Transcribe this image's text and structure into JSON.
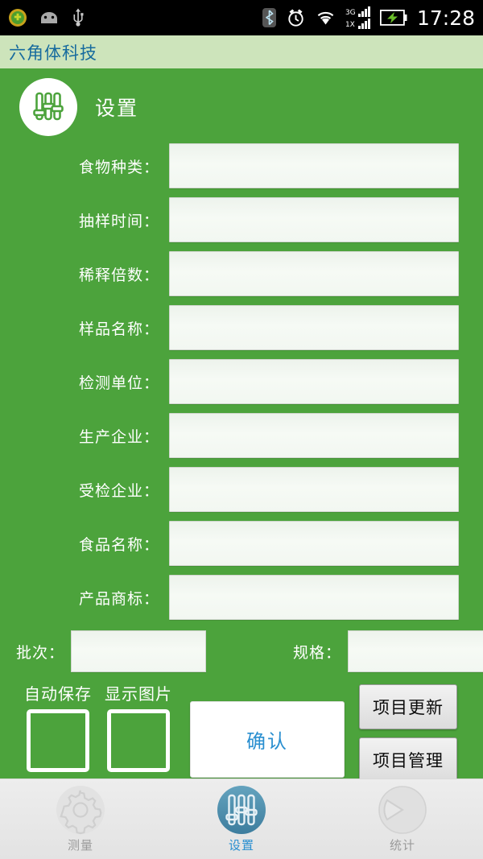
{
  "statusbar": {
    "icons_left": [
      "security-shield-icon",
      "android-robot-icon",
      "usb-icon"
    ],
    "icons_right": [
      "bluetooth-icon",
      "alarm-clock-icon",
      "wifi-icon",
      "signal-icon",
      "battery-charging-icon"
    ],
    "signal_3g_label": "3G",
    "signal_1x_label": "1X",
    "clock": "17:28"
  },
  "titlebar": {
    "app_title": "六角体科技",
    "title_color": "#176B9E",
    "bg_color": "#CDE4BB"
  },
  "page": {
    "header_title": "设置",
    "header_icon": "sliders-icon",
    "accent_color": "#4CA33C",
    "fields": [
      {
        "label": "食物种类：",
        "value": "",
        "name": "food-type"
      },
      {
        "label": "抽样时间：",
        "value": "",
        "name": "sampling-time"
      },
      {
        "label": "稀释倍数：",
        "value": "",
        "name": "dilution-factor"
      },
      {
        "label": "样品名称：",
        "value": "",
        "name": "sample-name"
      },
      {
        "label": "检测单位：",
        "value": "",
        "name": "testing-unit"
      },
      {
        "label": "生产企业：",
        "value": "",
        "name": "producer-company"
      },
      {
        "label": "受检企业：",
        "value": "",
        "name": "inspected-company"
      },
      {
        "label": "食品名称：",
        "value": "",
        "name": "food-name"
      },
      {
        "label": "产品商标：",
        "value": "",
        "name": "product-brand"
      }
    ],
    "pair_fields": [
      {
        "label": "批次：",
        "value": "",
        "name": "batch"
      },
      {
        "label": "规格：",
        "value": "",
        "name": "specification"
      }
    ],
    "checkboxes": [
      {
        "label": "自动保存",
        "checked": false,
        "name": "auto-save"
      },
      {
        "label": "显示图片",
        "checked": false,
        "name": "show-image"
      }
    ],
    "confirm_button": {
      "label": "确认",
      "text_color": "#2A8FD0"
    },
    "side_buttons": [
      {
        "label": "项目更新",
        "name": "project-update"
      },
      {
        "label": "项目管理",
        "name": "project-manage"
      }
    ]
  },
  "navbar": {
    "active_color": "#2A8FD0",
    "inactive_color": "#9A9A9A",
    "items": [
      {
        "label": "测量",
        "icon": "gear-icon",
        "active": false
      },
      {
        "label": "设置",
        "icon": "sliders-icon",
        "active": true
      },
      {
        "label": "统计",
        "icon": "pie-chart-icon",
        "active": false
      }
    ]
  }
}
